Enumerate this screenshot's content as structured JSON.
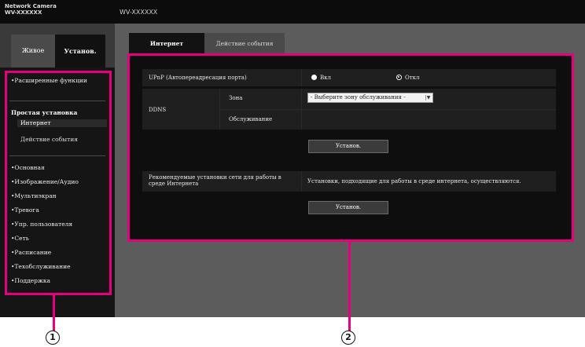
{
  "header": {
    "logo_line1": "Network Camera",
    "logo_line2": "WV-XXXXXX",
    "model": "WV-XXXXXX"
  },
  "sidebar": {
    "tab_live": "Живое",
    "tab_setup": "Установ.",
    "items": [
      "•Расширенные функции",
      "Простая установка",
      "Интернет",
      "Действие события",
      "•Основная",
      "•Изображение/Аудио",
      "•Мультиэкран",
      "•Тревога",
      "•Упр. пользователя",
      "•Сеть",
      "•Расписание",
      "•Техобслуживание",
      "•Поддержка"
    ]
  },
  "main": {
    "tabs": [
      "Интернет",
      "Действие события"
    ],
    "upnp_label": "UPnP (Автопереадресация порта)",
    "upnp_on": "Вкл",
    "upnp_off": "Откл",
    "ddns_label": "DDNS",
    "zone_label": "Зона",
    "zone_value": "- Выберите зону обслуживания -",
    "service_label": "Обслуживание",
    "set_button": "Установ.",
    "recommend_label": "Рекомендуемые установки сети для работы в среде Интернета",
    "recommend_text": "Установки, подходящие для работы в среде интернета, осуществляются.",
    "set_button_2": "Установ."
  },
  "callouts": [
    "1",
    "2"
  ],
  "colors": {
    "highlight": "#e6007e",
    "background": "#5c5c5c"
  }
}
